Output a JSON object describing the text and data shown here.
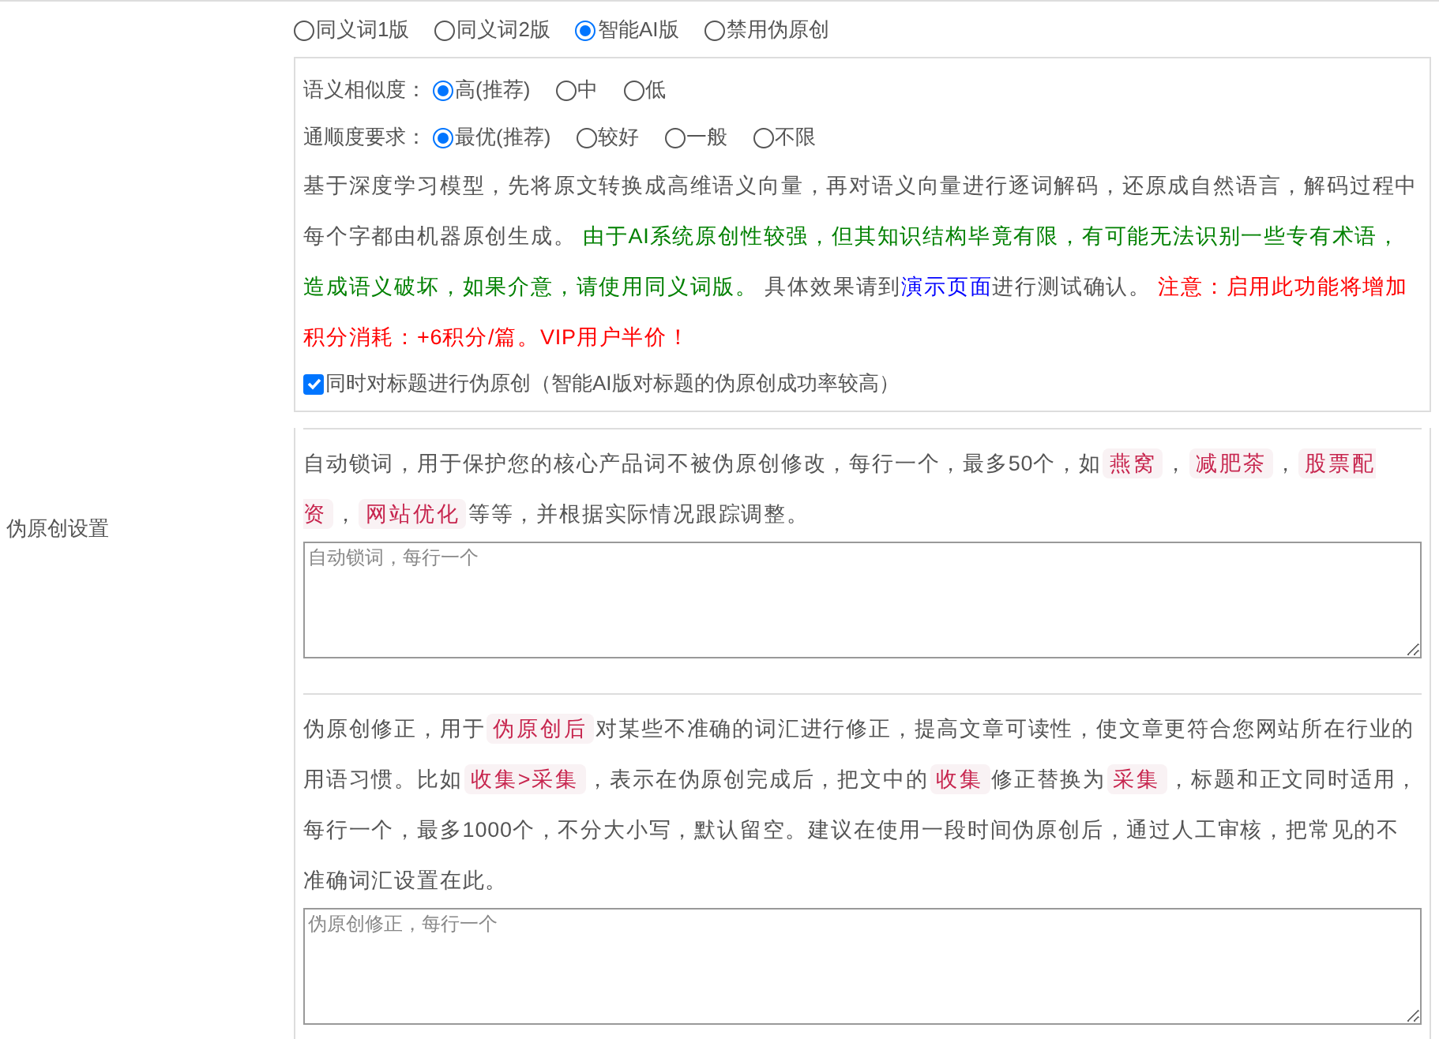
{
  "mode_options": [
    {
      "label": "同义词1版",
      "selected": false
    },
    {
      "label": "同义词2版",
      "selected": false
    },
    {
      "label": "智能AI版",
      "selected": true
    },
    {
      "label": "禁用伪原创",
      "selected": false
    }
  ],
  "similarity": {
    "label": "语义相似度：",
    "options": [
      {
        "label": "高(推荐)",
        "selected": true
      },
      {
        "label": "中",
        "selected": false
      },
      {
        "label": "低",
        "selected": false
      }
    ]
  },
  "fluency": {
    "label": "通顺度要求：",
    "options": [
      {
        "label": "最优(推荐)",
        "selected": true
      },
      {
        "label": "较好",
        "selected": false
      },
      {
        "label": "一般",
        "selected": false
      },
      {
        "label": "不限",
        "selected": false
      }
    ]
  },
  "ai_description": [
    {
      "kind": "text",
      "text": "基于深度学习模型，先将原文转换成高维语义向量，再对语义向量进行逐词解码，还原成自然语言，解码过程中每个字都由机器原创生成。 "
    },
    {
      "kind": "green",
      "text": "由于AI系统原创性较强，但其知识结构毕竟有限，有可能无法识别一些专有术语，造成语义破坏，如果介意，请使用同义词版。"
    },
    {
      "kind": "text",
      "text": " 具体效果请到"
    },
    {
      "kind": "link",
      "text": "演示页面"
    },
    {
      "kind": "text",
      "text": "进行测试确认。 "
    },
    {
      "kind": "red",
      "text": "注意：启用此功能将增加积分消耗：+6积分/篇。VIP用户半价！"
    }
  ],
  "title_option": {
    "label": "同时对标题进行伪原创（智能AI版对标题的伪原创成功率较高）",
    "checked": true
  },
  "settings_label": "伪原创设置",
  "lock_words": {
    "description": [
      {
        "kind": "text",
        "text": "自动锁词，用于保护您的核心产品词不被伪原创修改，每行一个，最多50个，如"
      },
      {
        "kind": "code",
        "text": "燕窝"
      },
      {
        "kind": "text",
        "text": "，"
      },
      {
        "kind": "code",
        "text": "减肥茶"
      },
      {
        "kind": "text",
        "text": "，"
      },
      {
        "kind": "code",
        "text": "股票配资"
      },
      {
        "kind": "text",
        "text": "，"
      },
      {
        "kind": "code",
        "text": "网站优化"
      },
      {
        "kind": "text",
        "text": "等等，并根据实际情况跟踪调整。"
      }
    ],
    "placeholder": "自动锁词，每行一个"
  },
  "corrections": {
    "description": [
      {
        "kind": "text",
        "text": "伪原创修正，用于"
      },
      {
        "kind": "code",
        "text": "伪原创后"
      },
      {
        "kind": "text",
        "text": "对某些不准确的词汇进行修正，提高文章可读性，使文章更符合您网站所在行业的用语习惯。比如"
      },
      {
        "kind": "code",
        "text": "收集>采集"
      },
      {
        "kind": "text",
        "text": "，表示在伪原创完成后，把文中的"
      },
      {
        "kind": "code",
        "text": "收集"
      },
      {
        "kind": "text",
        "text": "修正替换为"
      },
      {
        "kind": "code",
        "text": "采集"
      },
      {
        "kind": "text",
        "text": "，标题和正文同时适用，每行一个，最多1000个，不分大小写，默认留空。建议在使用一段时间伪原创后，通过人工审核，把常见的不准确词汇设置在此。"
      }
    ],
    "placeholder": "伪原创修正，每行一个"
  }
}
